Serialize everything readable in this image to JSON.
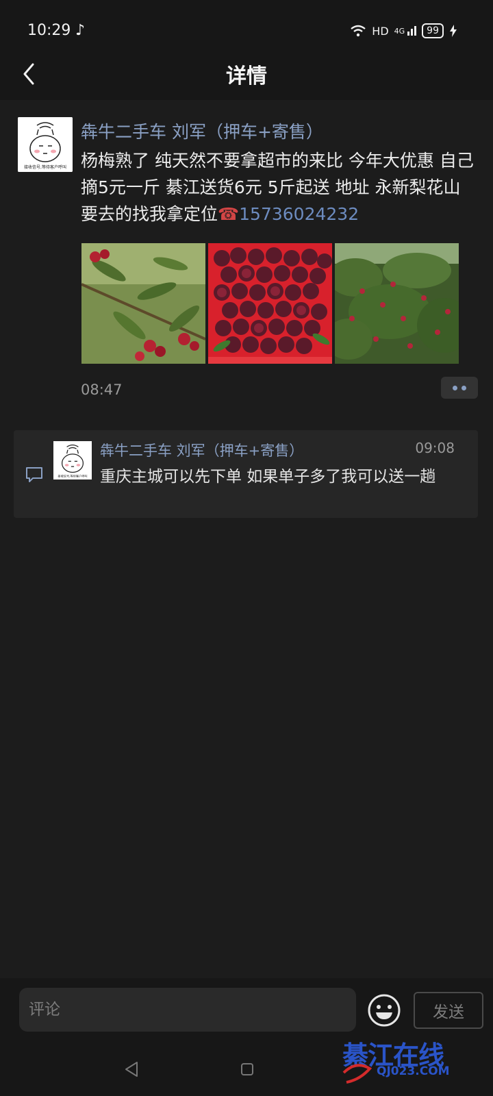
{
  "status_bar": {
    "time": "10:29",
    "music_icon": "music-note-icon",
    "network": "HD",
    "signal": "4G",
    "battery": "99"
  },
  "header": {
    "title": "详情",
    "back_icon": "chevron-left-icon"
  },
  "post": {
    "author": "犇牛二手车 刘军（押车+寄售）",
    "text": "杨梅熟了 纯天然不要拿超市的来比 今年大优惠 自己摘5元一斤 綦江送货6元 5斤起送  地址 永新梨花山 要去的找我拿定位",
    "phone_icon": "☎",
    "phone": "15736024232",
    "photos": [
      "red-bayberries-on-branch",
      "bayberries-in-red-basket",
      "bayberry-tree"
    ],
    "time": "08:47",
    "avatar_caption": "接收信号,等待客户呼叫"
  },
  "comments": [
    {
      "author": "犇牛二手车 刘军（押车+寄售）",
      "time": "09:08",
      "text": "重庆主城可以先下单  如果单子多了我可以送一趟"
    }
  ],
  "comment_bar": {
    "placeholder": "评论",
    "send_label": "发送",
    "emoji_icon": "smiley-face-icon"
  },
  "watermark": {
    "chinese": "綦江在线",
    "domain": "QJ023.COM"
  },
  "colors": {
    "background": "#1c1c1c",
    "author_link": "#8aa0c4",
    "phone_link": "#6d8cc0",
    "watermark_blue": "#2a54c8",
    "watermark_red": "#d42b2b"
  }
}
